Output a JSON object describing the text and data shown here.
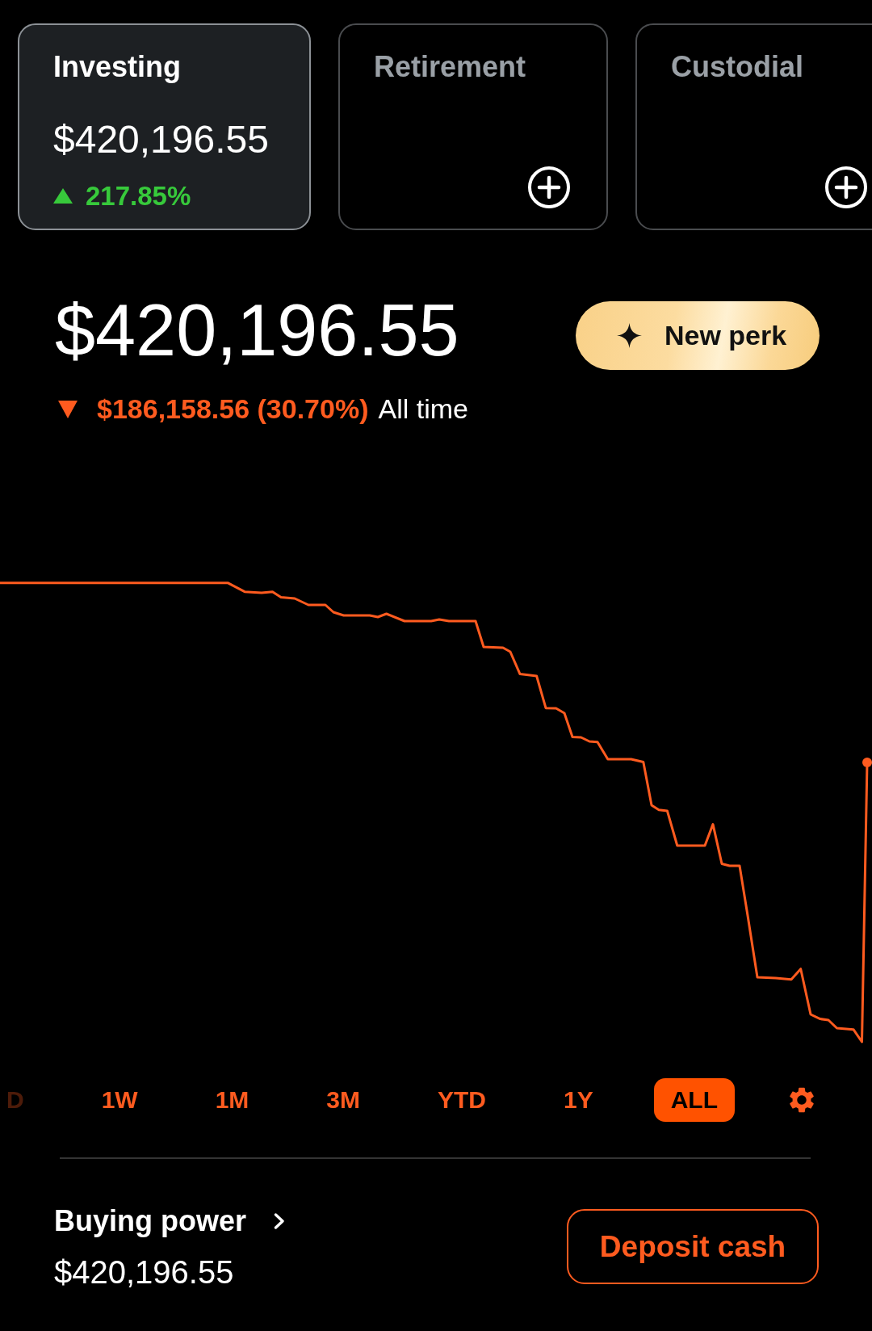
{
  "accounts": [
    {
      "kind": "balance",
      "title": "Investing",
      "selected": true,
      "amount": "$420,196.55",
      "change": {
        "positive": true,
        "value": "217.85%"
      }
    },
    {
      "kind": "add",
      "title": "Retirement",
      "selected": false
    },
    {
      "kind": "add",
      "title": "Custodial",
      "selected": false
    }
  ],
  "portfolio": {
    "value": "$420,196.55",
    "change": {
      "positive": false,
      "value": "$186,158.56 (30.70%)",
      "period": "All time"
    }
  },
  "perk_button": {
    "label": "New perk"
  },
  "ranges": [
    {
      "label": "D",
      "selected": false
    },
    {
      "label": "1W",
      "selected": false
    },
    {
      "label": "1M",
      "selected": false
    },
    {
      "label": "3M",
      "selected": false
    },
    {
      "label": "YTD",
      "selected": false
    },
    {
      "label": "1Y",
      "selected": false
    },
    {
      "label": "ALL",
      "selected": true
    }
  ],
  "buying_power": {
    "label": "Buying power",
    "value": "$420,196.55"
  },
  "deposit_button": {
    "label": "Deposit cash"
  }
}
